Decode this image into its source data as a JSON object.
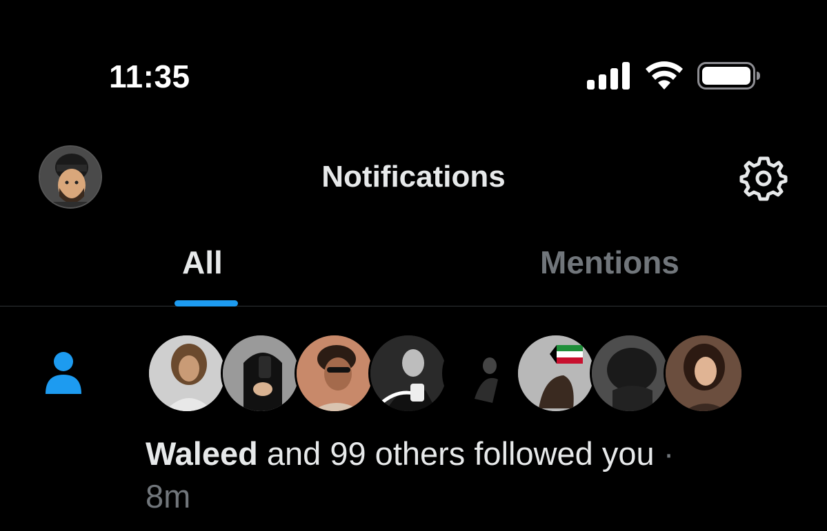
{
  "status_bar": {
    "time": "11:35",
    "icons": [
      "cellular-signal-icon",
      "wifi-icon",
      "battery-icon"
    ]
  },
  "header": {
    "title": "Notifications",
    "avatar_icon": "profile-avatar",
    "settings_icon": "gear-icon"
  },
  "tabs": [
    {
      "label": "All",
      "active": true
    },
    {
      "label": "Mentions",
      "active": false
    }
  ],
  "colors": {
    "background": "#000000",
    "accent": "#1d9bf0",
    "primary_text": "#e7e9ea",
    "secondary_text": "#71767b",
    "divider": "#2f3336"
  },
  "notification": {
    "icon": "person-icon",
    "name": "Waleed",
    "text": " and 99 others followed you",
    "separator": " ·",
    "time": "8m",
    "avatar_count": 8
  }
}
